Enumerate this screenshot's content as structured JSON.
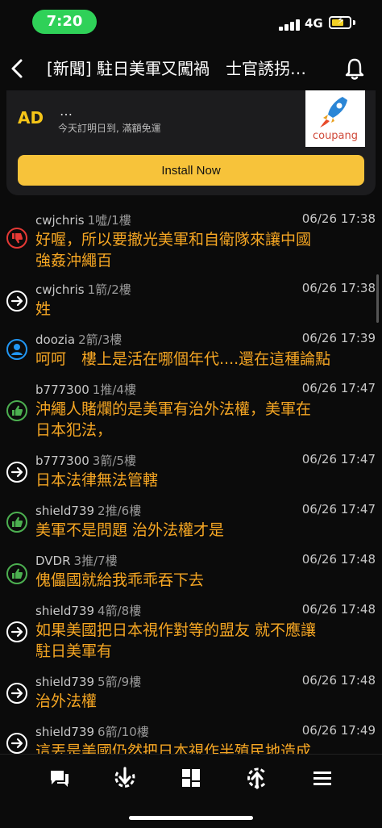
{
  "status": {
    "time": "7:20",
    "network": "4G"
  },
  "nav": {
    "title": "[新聞] 駐日美軍又闖禍　士官誘拐…"
  },
  "ad": {
    "label": "AD",
    "dots": "…",
    "subtitle": "今天訂明日到, 滿額免運",
    "logo_text": "coupang",
    "install_label": "Install Now"
  },
  "comments": [
    {
      "type": "boo",
      "user": "cwjchris",
      "tag": "1噓/1樓",
      "time": "06/26 17:38",
      "lines": [
        "好喔，所以要撤光美軍和自衛隊來讓中國",
        "強姦沖繩百"
      ]
    },
    {
      "type": "arrow",
      "user": "cwjchris",
      "tag": "1箭/2樓",
      "time": "06/26 17:38",
      "lines": [
        "姓"
      ]
    },
    {
      "type": "neutral",
      "user": "doozia",
      "tag": "2箭/3樓",
      "time": "06/26 17:39",
      "lines": [
        "呵呵　樓上是活在哪個年代....還在這種論點"
      ]
    },
    {
      "type": "push",
      "user": "b777300",
      "tag": "1推/4樓",
      "time": "06/26 17:47",
      "lines": [
        "沖繩人賭爛的是美軍有治外法權，美軍在",
        "日本犯法，"
      ]
    },
    {
      "type": "arrow",
      "user": "b777300",
      "tag": "3箭/5樓",
      "time": "06/26 17:47",
      "lines": [
        "日本法律無法管轄"
      ]
    },
    {
      "type": "push",
      "user": "shield739",
      "tag": "2推/6樓",
      "time": "06/26 17:47",
      "lines": [
        "美軍不是問題 治外法權才是"
      ]
    },
    {
      "type": "push",
      "user": "DVDR",
      "tag": "3推/7樓",
      "time": "06/26 17:48",
      "lines": [
        "傀儡國就給我乖乖吞下去"
      ]
    },
    {
      "type": "arrow",
      "user": "shield739",
      "tag": "4箭/8樓",
      "time": "06/26 17:48",
      "lines": [
        "如果美國把日本視作對等的盟友 就不應讓",
        "駐日美軍有"
      ]
    },
    {
      "type": "arrow",
      "user": "shield739",
      "tag": "5箭/9樓",
      "time": "06/26 17:48",
      "lines": [
        "治外法權"
      ]
    },
    {
      "type": "arrow",
      "user": "shield739",
      "tag": "6箭/10樓",
      "time": "06/26 17:49",
      "lines": [
        "這丟是美國仍然把日本視作半殖民地造成"
      ]
    }
  ],
  "colors": {
    "accent": "#f5a623",
    "push": "#4caf50",
    "boo": "#e53935",
    "neutral": "#2196f3",
    "install": "#f7c33a"
  },
  "toolbar": {
    "icons": [
      "comments-icon",
      "jump-to-bottom-icon",
      "grid-icon",
      "refresh-icon",
      "menu-icon"
    ]
  }
}
